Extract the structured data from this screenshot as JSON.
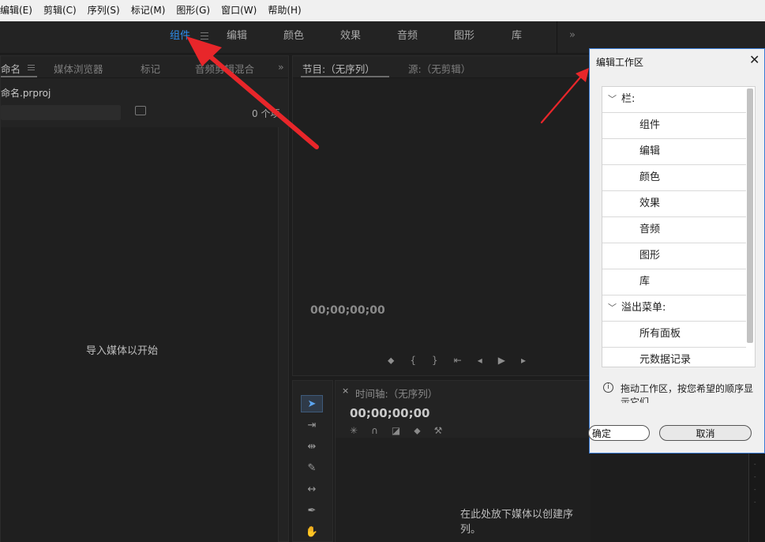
{
  "menu": [
    "编辑(E)",
    "剪辑(C)",
    "序列(S)",
    "标记(M)",
    "图形(G)",
    "窗口(W)",
    "帮助(H)"
  ],
  "workspaces": [
    "组件",
    "编辑",
    "颜色",
    "效果",
    "音频",
    "图形",
    "库"
  ],
  "workspace_more": "»",
  "project_panel": {
    "tabs": [
      "命名",
      "媒体浏览器",
      "标记",
      "音频剪辑混合"
    ],
    "title": "命名.prproj",
    "count": "0 个项",
    "empty": "导入媒体以开始",
    "more": "»"
  },
  "program_monitor": {
    "tabs": [
      "节目:（无序列）",
      "源:（无剪辑）"
    ],
    "timecode": "00;00;00;00"
  },
  "timeline": {
    "close": "×",
    "title": "时间轴:（无序列）",
    "timecode": "00;00;00;00",
    "empty": "在此处放下媒体以创建序列。"
  },
  "dialog": {
    "title": "编辑工作区",
    "close": "✕",
    "group_bar": "栏:",
    "bar_items": [
      "组件",
      "编辑",
      "颜色",
      "效果",
      "音频",
      "图形",
      "库"
    ],
    "group_overflow": "溢出菜单:",
    "overflow_items": [
      "所有面板",
      "元数据记录"
    ],
    "info": "拖动工作区，按您希望的顺序显示它们。",
    "ok": "确定",
    "cancel": "取消"
  },
  "colors": {
    "accent": "#2d8ceb",
    "arrow": "#e8262a",
    "dialog_border": "#3a7bd5"
  }
}
